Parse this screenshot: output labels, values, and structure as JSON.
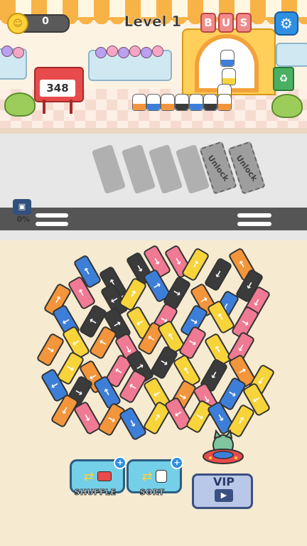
{
  "header": {
    "coin_value": "0",
    "level_label": "Level 1",
    "bus_sign_letters": [
      "B",
      "U",
      "S"
    ],
    "settings_icon": "gear-icon"
  },
  "shop": {
    "counter_value": "348",
    "recycle_icon": "recycle-icon"
  },
  "road": {
    "unlock_labels": [
      "Unlock",
      "Unlock"
    ],
    "progress_percent": "0%"
  },
  "tools": {
    "shuffle_label": "SHUFFLE",
    "sort_label": "SORT",
    "plus_symbol": "+",
    "vip_label": "VIP"
  },
  "colors": {
    "blue": "#3d7fd8",
    "yellow": "#f7d43a",
    "orange": "#f3953a",
    "black": "#3b3b3b",
    "pink": "#f07a93"
  }
}
